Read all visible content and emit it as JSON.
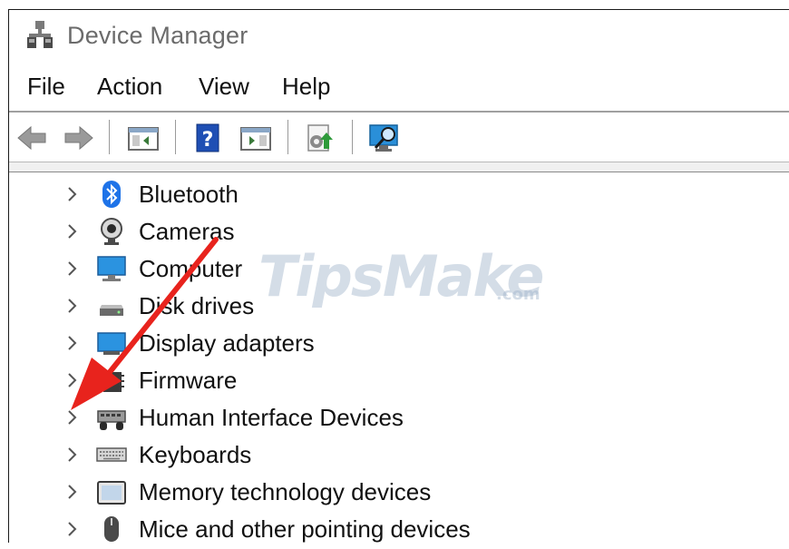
{
  "window": {
    "title": "Device Manager",
    "icon": "device-manager-icon"
  },
  "menu": [
    "File",
    "Action",
    "View",
    "Help"
  ],
  "toolbar": {
    "buttons": [
      "back-icon",
      "forward-icon",
      "show-hide-console-tree-icon",
      "help-icon",
      "properties-icon",
      "update-driver-icon",
      "scan-hardware-icon"
    ]
  },
  "tree": {
    "items": [
      {
        "label": "Bluetooth",
        "icon": "bluetooth-icon"
      },
      {
        "label": "Cameras",
        "icon": "camera-icon"
      },
      {
        "label": "Computer",
        "icon": "computer-icon"
      },
      {
        "label": "Disk drives",
        "icon": "disk-drive-icon"
      },
      {
        "label": "Display adapters",
        "icon": "display-adapter-icon"
      },
      {
        "label": "Firmware",
        "icon": "firmware-icon"
      },
      {
        "label": "Human Interface Devices",
        "icon": "hid-icon"
      },
      {
        "label": "Keyboards",
        "icon": "keyboard-icon"
      },
      {
        "label": "Memory technology devices",
        "icon": "memory-device-icon"
      },
      {
        "label": "Mice and other pointing devices",
        "icon": "mouse-icon"
      }
    ]
  },
  "watermark": {
    "brand": "TipsMake",
    "suffix": ".com"
  },
  "annotation": {
    "arrow_color": "#e8231d"
  },
  "colors": {
    "accent": "#1e73c8",
    "title_text": "#6b6b6b"
  }
}
